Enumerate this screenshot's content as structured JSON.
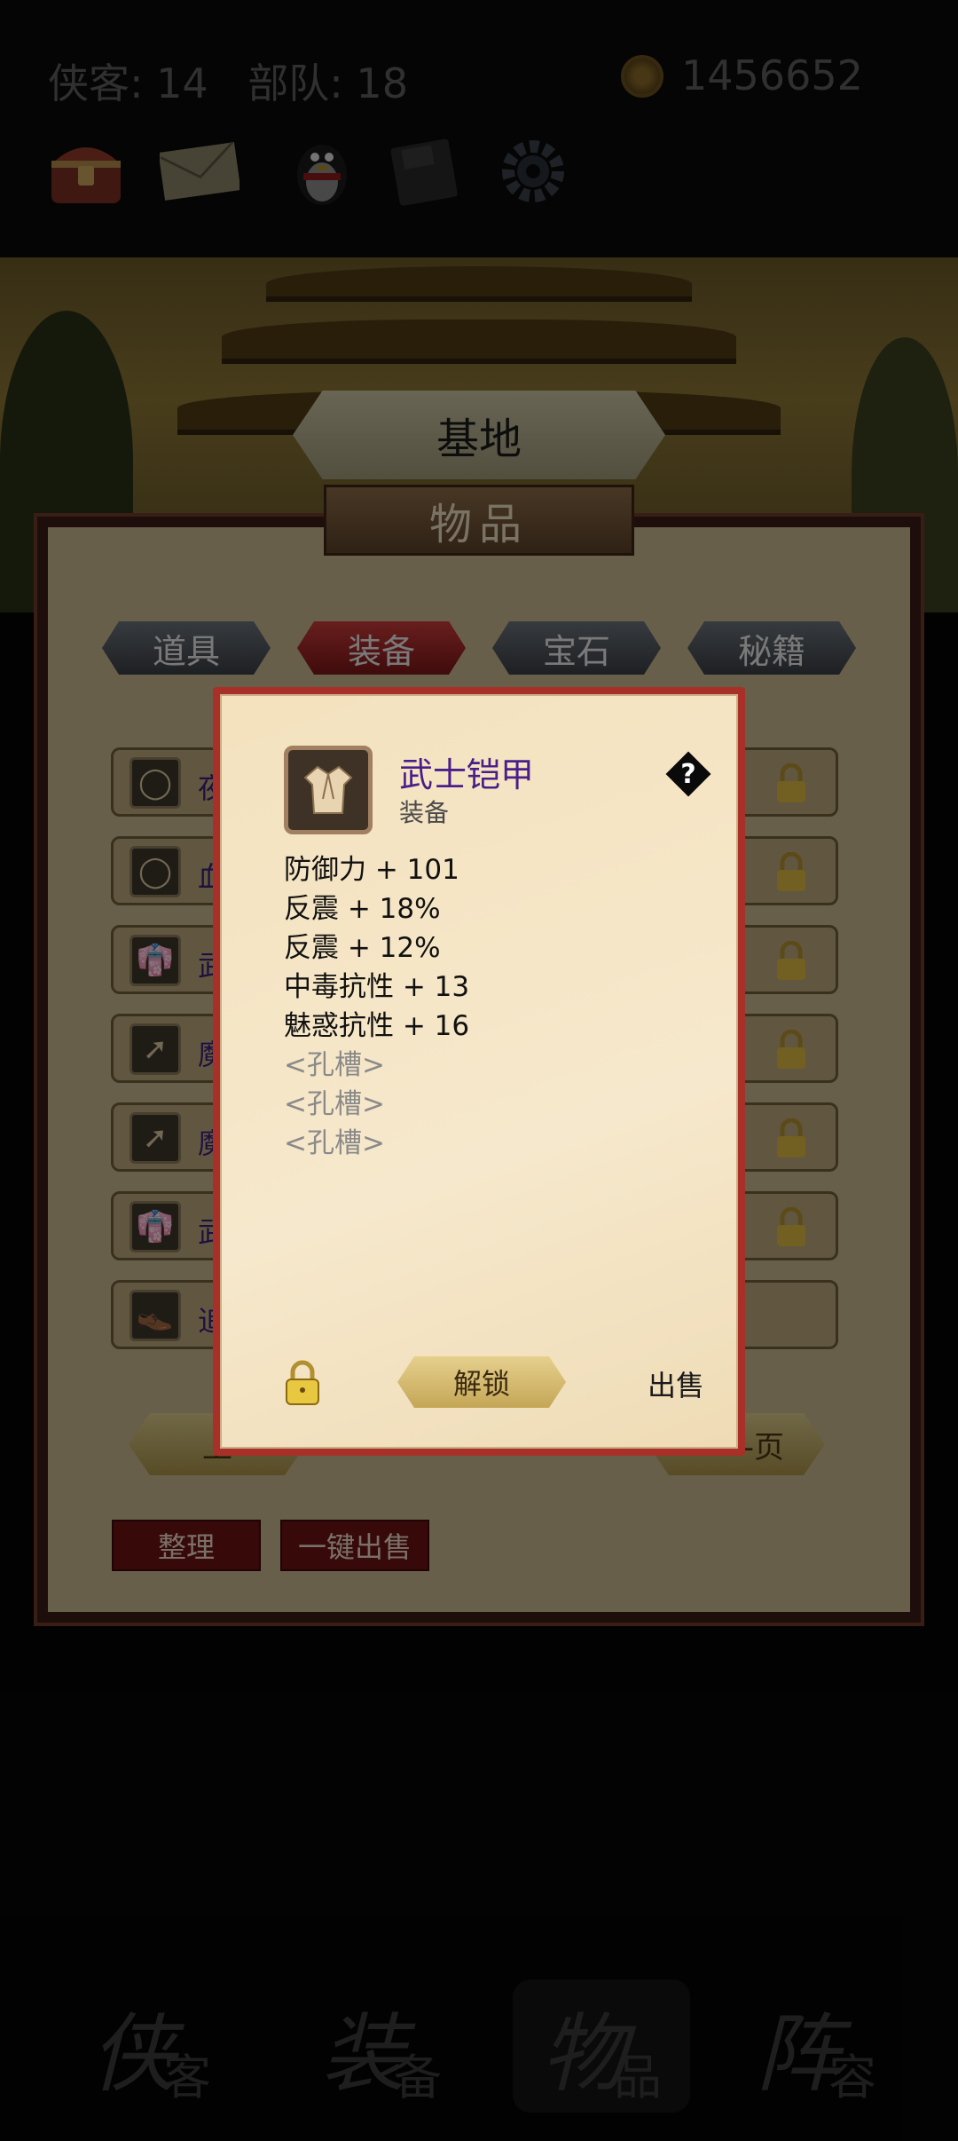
{
  "topbar": {
    "heroes_label": "侠客:",
    "heroes_count": "14",
    "troops_label": "部队:",
    "troops_count": "18",
    "coins": "1456652",
    "icons": [
      "treasure-chest-icon",
      "mail-icon",
      "qq-penguin-icon",
      "save-disk-icon",
      "settings-gear-icon"
    ]
  },
  "location": "基地",
  "panel_title": "物品",
  "tabs": [
    {
      "label": "道具",
      "active": false
    },
    {
      "label": "装备",
      "active": true
    },
    {
      "label": "宝石",
      "active": false
    },
    {
      "label": "秘籍",
      "active": false
    }
  ],
  "items": [
    {
      "icon": "ring-icon",
      "name_visible": "夜"
    },
    {
      "icon": "ring-icon",
      "name_visible": "血"
    },
    {
      "icon": "robe-icon",
      "name_visible": "武"
    },
    {
      "icon": "arrow-icon",
      "name_visible": "魔"
    },
    {
      "icon": "arrow-icon",
      "name_visible": "魔"
    },
    {
      "icon": "robe-icon",
      "name_visible": "武"
    },
    {
      "icon": "shoe-icon",
      "name_visible": "追"
    }
  ],
  "paging": {
    "prev_label": "上一页",
    "next_label": "下一页",
    "prev_visible": "上",
    "next_visible": "-页"
  },
  "footer_buttons": {
    "sort": "整理",
    "sell_all": "一键出售"
  },
  "popup": {
    "name": "武士铠甲",
    "type": "装备",
    "stats": [
      "防御力 + 101",
      "反震 + 18%",
      "反震 + 12%",
      "中毒抗性 + 13",
      "魅惑抗性 + 16"
    ],
    "slots": [
      "<孔槽>",
      "<孔槽>",
      "<孔槽>"
    ],
    "unlock_label": "解锁",
    "sell_label": "出售"
  },
  "bottom_nav": [
    {
      "big": "侠",
      "small": "客",
      "active": false
    },
    {
      "big": "装",
      "small": "备",
      "active": false
    },
    {
      "big": "物",
      "small": "品",
      "active": true
    },
    {
      "big": "阵",
      "small": "容",
      "active": false
    }
  ]
}
